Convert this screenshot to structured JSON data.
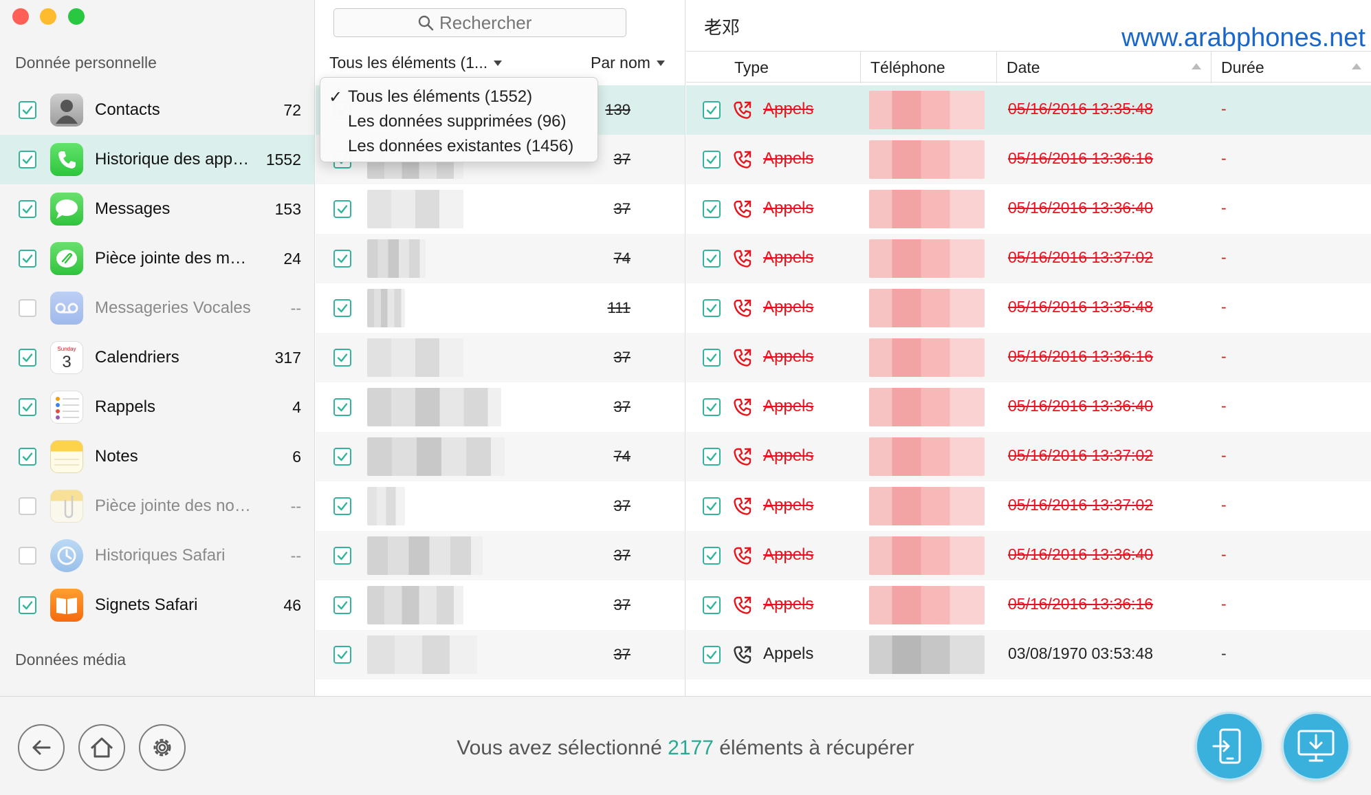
{
  "window": {
    "traffic_colors": [
      "#fe5f57",
      "#febb2e",
      "#2ac840"
    ]
  },
  "sidebar": {
    "section_personal": "Donnée personnelle",
    "section_media": "Données média",
    "items": [
      {
        "label": "Contacts",
        "count": "72",
        "checked": true,
        "icon": "contacts-icon"
      },
      {
        "label": "Historique des appels",
        "count": "1552",
        "checked": true,
        "icon": "phone-icon",
        "selected": true
      },
      {
        "label": "Messages",
        "count": "153",
        "checked": true,
        "icon": "messages-icon"
      },
      {
        "label": "Pièce jointe des messages",
        "count": "24",
        "checked": true,
        "icon": "paperclip-icon"
      },
      {
        "label": "Messageries Vocales",
        "count": "--",
        "checked": false,
        "icon": "voicemail-icon"
      },
      {
        "label": "Calendriers",
        "count": "317",
        "checked": true,
        "icon": "calendar-icon"
      },
      {
        "label": "Rappels",
        "count": "4",
        "checked": true,
        "icon": "reminders-icon"
      },
      {
        "label": "Notes",
        "count": "6",
        "checked": true,
        "icon": "notes-icon"
      },
      {
        "label": "Pièce jointe des notes",
        "count": "--",
        "checked": false,
        "icon": "note-attachment-icon"
      },
      {
        "label": "Historiques Safari",
        "count": "--",
        "checked": false,
        "icon": "safari-history-icon"
      },
      {
        "label": "Signets Safari",
        "count": "46",
        "checked": true,
        "icon": "bookmarks-icon"
      }
    ],
    "calendar_day": "Sunday",
    "calendar_date": "3"
  },
  "middle": {
    "search_placeholder": "Rechercher",
    "filter_label": "Tous les éléments (1...",
    "sort_label": "Par nom",
    "dropdown": [
      {
        "label": "Tous les éléments (1552)",
        "checked": true
      },
      {
        "label": "Les données supprimées (96)",
        "checked": false
      },
      {
        "label": "Les données existantes (1456)",
        "checked": false
      }
    ],
    "rows": [
      {
        "count": "139"
      },
      {
        "count": "37"
      },
      {
        "count": "37"
      },
      {
        "count": "74"
      },
      {
        "count": "111"
      },
      {
        "count": "37"
      },
      {
        "count": "37"
      },
      {
        "count": "74"
      },
      {
        "count": "37"
      },
      {
        "count": "37"
      },
      {
        "count": "37"
      },
      {
        "count": "37"
      }
    ]
  },
  "detail": {
    "contact_name": "老邓",
    "watermark": "www.arabphones.net",
    "columns": {
      "type": "Type",
      "phone": "Téléphone",
      "date": "Date",
      "duration": "Durée"
    },
    "rows": [
      {
        "type": "Appels",
        "date": "05/16/2016 13:35:48",
        "duration": "-",
        "deleted": true
      },
      {
        "type": "Appels",
        "date": "05/16/2016 13:36:16",
        "duration": "-",
        "deleted": true
      },
      {
        "type": "Appels",
        "date": "05/16/2016 13:36:40",
        "duration": "-",
        "deleted": true
      },
      {
        "type": "Appels",
        "date": "05/16/2016 13:37:02",
        "duration": "-",
        "deleted": true
      },
      {
        "type": "Appels",
        "date": "05/16/2016 13:35:48",
        "duration": "-",
        "deleted": true
      },
      {
        "type": "Appels",
        "date": "05/16/2016 13:36:16",
        "duration": "-",
        "deleted": true
      },
      {
        "type": "Appels",
        "date": "05/16/2016 13:36:40",
        "duration": "-",
        "deleted": true
      },
      {
        "type": "Appels",
        "date": "05/16/2016 13:37:02",
        "duration": "-",
        "deleted": true
      },
      {
        "type": "Appels",
        "date": "05/16/2016 13:37:02",
        "duration": "-",
        "deleted": true
      },
      {
        "type": "Appels",
        "date": "05/16/2016 13:36:40",
        "duration": "-",
        "deleted": true
      },
      {
        "type": "Appels",
        "date": "05/16/2016 13:36:16",
        "duration": "-",
        "deleted": true
      },
      {
        "type": "Appels",
        "date": "03/08/1970 03:53:48",
        "duration": "-",
        "deleted": false
      }
    ]
  },
  "footer": {
    "status_prefix": "Vous avez sélectionné",
    "status_count": "2177",
    "status_suffix": "éléments à récupérer"
  },
  "colors": {
    "accent": "#33b39c",
    "deleted": "#e8141c",
    "primary_button": "#3ab1dc",
    "selected_row": "#dbf0ec"
  }
}
